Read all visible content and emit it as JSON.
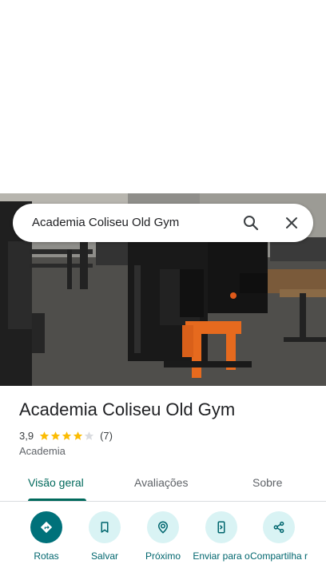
{
  "search": {
    "query": "Academia Coliseu Old Gym",
    "search_icon": "search-icon",
    "close_icon": "close-icon"
  },
  "place": {
    "name": "Academia Coliseu Old Gym",
    "rating": "3,9",
    "rating_stars_filled": 4,
    "review_count": "(7)",
    "category": "Academia",
    "photo_description_icon": "gym-photo"
  },
  "tabs": [
    {
      "label": "Visão geral",
      "active": true
    },
    {
      "label": "Avaliações",
      "active": false
    },
    {
      "label": "Sobre",
      "active": false
    }
  ],
  "actions": [
    {
      "label": "Rotas",
      "icon": "directions-icon"
    },
    {
      "label": "Salvar",
      "icon": "bookmark-icon"
    },
    {
      "label": "Próximo",
      "icon": "nearby-icon"
    },
    {
      "label": "Enviar para o",
      "icon": "send-to-phone-icon"
    },
    {
      "label": "Compartilha r",
      "icon": "share-icon"
    }
  ],
  "colors": {
    "accent": "#00695c",
    "action_bg": "#d9f3f4",
    "action_primary_bg": "#00717a",
    "star": "#fbbc04",
    "star_empty": "#dadce0"
  }
}
